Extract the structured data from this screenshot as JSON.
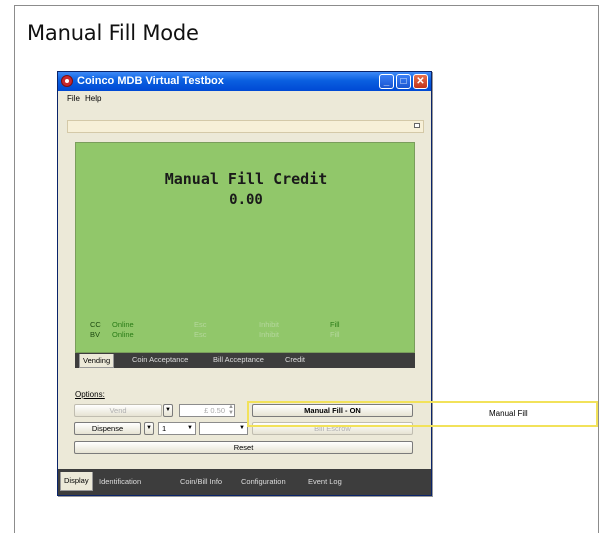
{
  "page_heading": "Manual Fill Mode",
  "window": {
    "title": "Coinco MDB Virtual Testbox",
    "controls": {
      "minimize": "_",
      "maximize": "□",
      "close": "✕"
    }
  },
  "menu": {
    "file": "File",
    "help": "Help"
  },
  "display": {
    "title": "Manual Fill Credit",
    "value": "0.00",
    "status": {
      "cc_label": "CC",
      "bv_label": "BV",
      "cc_state": "Online",
      "bv_state": "Online",
      "cc_col2": "Esc",
      "bv_col2": "Esc",
      "cc_col3": "Inhibit",
      "bv_col3": "Inhibit",
      "cc_fill": "Fill",
      "bv_fill": "Fill"
    }
  },
  "tabs": {
    "vending": "Vending",
    "coin_acceptance": "Coin Acceptance",
    "bill_acceptance": "Bill Acceptance",
    "credit": "Credit"
  },
  "options": {
    "label": "Options:",
    "vend_label": "Vend",
    "price_value": "£  0.50",
    "manual_fill_label": "Manual Fill - ON",
    "dispense_label": "Dispense",
    "quantity_value": "1",
    "bill_escrow_label": "Bill Escrow",
    "reset_label": "Reset"
  },
  "bottom_tabs": {
    "display": "Display",
    "identification": "Identification",
    "coin_bill_info": "Coin/Bill Info",
    "configuration": "Configuration",
    "event_log": "Event Log"
  },
  "callout": {
    "label": "Manual Fill",
    "color": "#f2e25a"
  },
  "colors": {
    "lcd_background": "#91c76a",
    "titlebar": "#0a5fe0"
  }
}
